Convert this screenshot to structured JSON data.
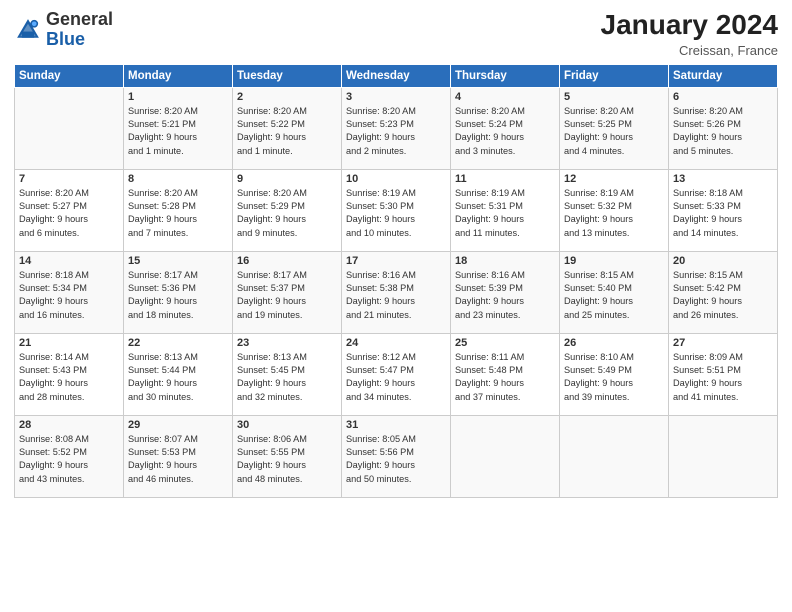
{
  "header": {
    "logo_general": "General",
    "logo_blue": "Blue",
    "month_year": "January 2024",
    "location": "Creissan, France"
  },
  "days_of_week": [
    "Sunday",
    "Monday",
    "Tuesday",
    "Wednesday",
    "Thursday",
    "Friday",
    "Saturday"
  ],
  "weeks": [
    [
      {
        "day": "",
        "info": ""
      },
      {
        "day": "1",
        "info": "Sunrise: 8:20 AM\nSunset: 5:21 PM\nDaylight: 9 hours\nand 1 minute."
      },
      {
        "day": "2",
        "info": "Sunrise: 8:20 AM\nSunset: 5:22 PM\nDaylight: 9 hours\nand 1 minute."
      },
      {
        "day": "3",
        "info": "Sunrise: 8:20 AM\nSunset: 5:23 PM\nDaylight: 9 hours\nand 2 minutes."
      },
      {
        "day": "4",
        "info": "Sunrise: 8:20 AM\nSunset: 5:24 PM\nDaylight: 9 hours\nand 3 minutes."
      },
      {
        "day": "5",
        "info": "Sunrise: 8:20 AM\nSunset: 5:25 PM\nDaylight: 9 hours\nand 4 minutes."
      },
      {
        "day": "6",
        "info": "Sunrise: 8:20 AM\nSunset: 5:26 PM\nDaylight: 9 hours\nand 5 minutes."
      }
    ],
    [
      {
        "day": "7",
        "info": "Sunrise: 8:20 AM\nSunset: 5:27 PM\nDaylight: 9 hours\nand 6 minutes."
      },
      {
        "day": "8",
        "info": "Sunrise: 8:20 AM\nSunset: 5:28 PM\nDaylight: 9 hours\nand 7 minutes."
      },
      {
        "day": "9",
        "info": "Sunrise: 8:20 AM\nSunset: 5:29 PM\nDaylight: 9 hours\nand 9 minutes."
      },
      {
        "day": "10",
        "info": "Sunrise: 8:19 AM\nSunset: 5:30 PM\nDaylight: 9 hours\nand 10 minutes."
      },
      {
        "day": "11",
        "info": "Sunrise: 8:19 AM\nSunset: 5:31 PM\nDaylight: 9 hours\nand 11 minutes."
      },
      {
        "day": "12",
        "info": "Sunrise: 8:19 AM\nSunset: 5:32 PM\nDaylight: 9 hours\nand 13 minutes."
      },
      {
        "day": "13",
        "info": "Sunrise: 8:18 AM\nSunset: 5:33 PM\nDaylight: 9 hours\nand 14 minutes."
      }
    ],
    [
      {
        "day": "14",
        "info": "Sunrise: 8:18 AM\nSunset: 5:34 PM\nDaylight: 9 hours\nand 16 minutes."
      },
      {
        "day": "15",
        "info": "Sunrise: 8:17 AM\nSunset: 5:36 PM\nDaylight: 9 hours\nand 18 minutes."
      },
      {
        "day": "16",
        "info": "Sunrise: 8:17 AM\nSunset: 5:37 PM\nDaylight: 9 hours\nand 19 minutes."
      },
      {
        "day": "17",
        "info": "Sunrise: 8:16 AM\nSunset: 5:38 PM\nDaylight: 9 hours\nand 21 minutes."
      },
      {
        "day": "18",
        "info": "Sunrise: 8:16 AM\nSunset: 5:39 PM\nDaylight: 9 hours\nand 23 minutes."
      },
      {
        "day": "19",
        "info": "Sunrise: 8:15 AM\nSunset: 5:40 PM\nDaylight: 9 hours\nand 25 minutes."
      },
      {
        "day": "20",
        "info": "Sunrise: 8:15 AM\nSunset: 5:42 PM\nDaylight: 9 hours\nand 26 minutes."
      }
    ],
    [
      {
        "day": "21",
        "info": "Sunrise: 8:14 AM\nSunset: 5:43 PM\nDaylight: 9 hours\nand 28 minutes."
      },
      {
        "day": "22",
        "info": "Sunrise: 8:13 AM\nSunset: 5:44 PM\nDaylight: 9 hours\nand 30 minutes."
      },
      {
        "day": "23",
        "info": "Sunrise: 8:13 AM\nSunset: 5:45 PM\nDaylight: 9 hours\nand 32 minutes."
      },
      {
        "day": "24",
        "info": "Sunrise: 8:12 AM\nSunset: 5:47 PM\nDaylight: 9 hours\nand 34 minutes."
      },
      {
        "day": "25",
        "info": "Sunrise: 8:11 AM\nSunset: 5:48 PM\nDaylight: 9 hours\nand 37 minutes."
      },
      {
        "day": "26",
        "info": "Sunrise: 8:10 AM\nSunset: 5:49 PM\nDaylight: 9 hours\nand 39 minutes."
      },
      {
        "day": "27",
        "info": "Sunrise: 8:09 AM\nSunset: 5:51 PM\nDaylight: 9 hours\nand 41 minutes."
      }
    ],
    [
      {
        "day": "28",
        "info": "Sunrise: 8:08 AM\nSunset: 5:52 PM\nDaylight: 9 hours\nand 43 minutes."
      },
      {
        "day": "29",
        "info": "Sunrise: 8:07 AM\nSunset: 5:53 PM\nDaylight: 9 hours\nand 46 minutes."
      },
      {
        "day": "30",
        "info": "Sunrise: 8:06 AM\nSunset: 5:55 PM\nDaylight: 9 hours\nand 48 minutes."
      },
      {
        "day": "31",
        "info": "Sunrise: 8:05 AM\nSunset: 5:56 PM\nDaylight: 9 hours\nand 50 minutes."
      },
      {
        "day": "",
        "info": ""
      },
      {
        "day": "",
        "info": ""
      },
      {
        "day": "",
        "info": ""
      }
    ]
  ]
}
